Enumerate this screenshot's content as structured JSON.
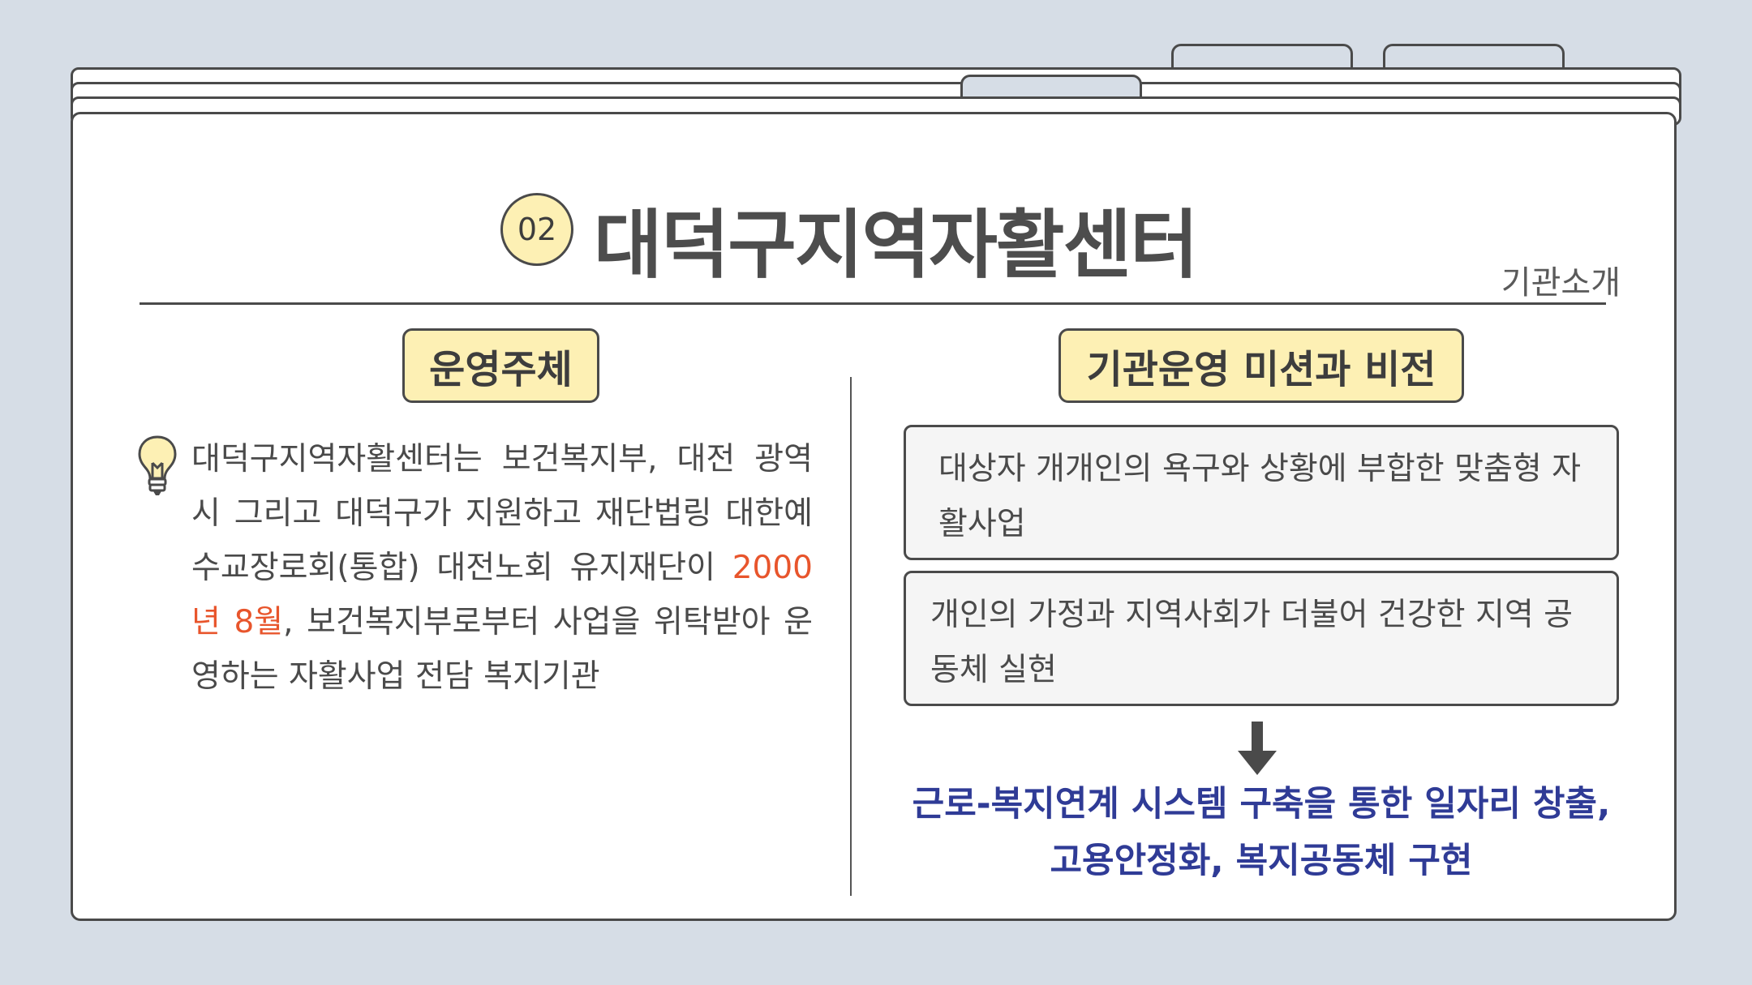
{
  "header": {
    "number": "02",
    "title": "대덕구지역자활센터",
    "subtitle": "기관소개"
  },
  "left": {
    "heading": "운영주체",
    "text_before": "대덕구지역자활센터는 보건복지부, 대전 광역시 그리고 대덕구가 지원하고 재단법링 대한예수교장로회(통합) 대전노회 유지재단이 ",
    "text_highlight": "2000년 8월",
    "text_after": ", 보건복지부로부터 사업을 위탁받아 운영하는 자활사업 전담 복지기관"
  },
  "right": {
    "heading": "기관운영 미션과 비전",
    "mission_1": "대상자 개개인의 욕구와 상황에 부합한 맞춤형 자활사업",
    "mission_2": "개인의 가정과 지역사회가 더불어 건강한 지역 공동체 실현",
    "goal_line_1": "근로-복지연계 시스템 구축을 통한 일자리 창출,",
    "goal_line_2": "고용안정화, 복지공동체 구현"
  },
  "colors": {
    "background": "#d6dde6",
    "pill_fill": "#fdf0b4",
    "accent_orange": "#e8552c",
    "goal_blue": "#2f3b96"
  },
  "icons": [
    "lightbulb-icon",
    "arrow-down-icon"
  ]
}
